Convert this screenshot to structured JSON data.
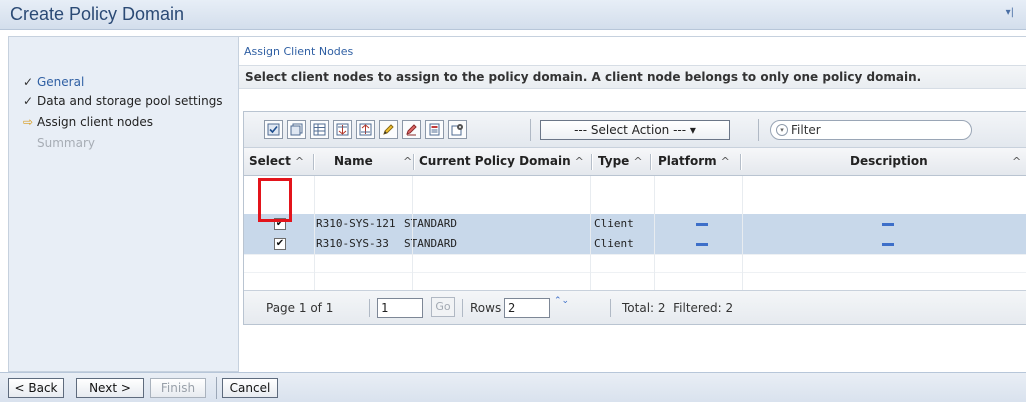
{
  "window": {
    "title": "Create Policy Domain",
    "collapse_glyph": "▾|"
  },
  "nav": {
    "items": [
      {
        "label": "General",
        "state": "done",
        "mark": "✓"
      },
      {
        "label": "Data and storage pool settings",
        "state": "done",
        "mark": "✓"
      },
      {
        "label": "Assign client nodes",
        "state": "current",
        "mark": "⇨"
      },
      {
        "label": "Summary",
        "state": "disabled",
        "mark": ""
      }
    ]
  },
  "page": {
    "section_label": "Assign Client Nodes",
    "description": "Select client nodes to assign to the policy domain. A client node belongs to only one policy domain."
  },
  "toolbar": {
    "icons": [
      "select-all-icon",
      "deselect-all-icon",
      "table-icon",
      "collapse-icon",
      "expand-icon",
      "edit-icon",
      "clear-icon",
      "properties-icon",
      "configure-icon"
    ],
    "select_action": "--- Select Action --- ▾",
    "filter_placeholder": "Filter"
  },
  "table": {
    "columns": [
      {
        "label": "Select",
        "sort": "^"
      },
      {
        "label": "Name",
        "sort": "^"
      },
      {
        "label": "Current Policy Domain",
        "sort": "^"
      },
      {
        "label": "Type",
        "sort": "^"
      },
      {
        "label": "Platform",
        "sort": "^"
      },
      {
        "label": "Description",
        "sort": "^"
      }
    ],
    "rows": [
      {
        "selected": true,
        "check": "✔",
        "name": "R310-SYS-121",
        "domain": "STANDARD",
        "type": "Client",
        "platform": "-",
        "description": "-"
      },
      {
        "selected": true,
        "check": "✔",
        "name": "R310-SYS-33",
        "domain": "STANDARD",
        "type": "Client",
        "platform": "-",
        "description": "-"
      }
    ]
  },
  "pager": {
    "page_text": "Page 1 of 1",
    "page_value": "1",
    "go_label": "Go",
    "rows_label": "Rows",
    "rows_value": "2",
    "spin_glyph": "⌃⌄",
    "totals": "Total: 2  Filtered: 2"
  },
  "footer": {
    "back": "< Back",
    "next": "Next >",
    "finish": "Finish",
    "cancel": "Cancel"
  },
  "colors": {
    "accent": "#2f5fa3",
    "selected_row": "#c8d8ea",
    "highlight_box": "#e3141b"
  }
}
